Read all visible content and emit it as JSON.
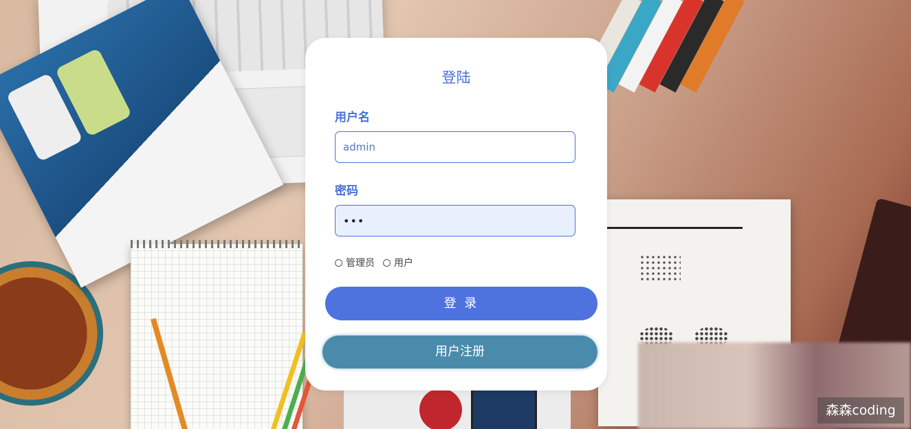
{
  "login": {
    "title": "登陆",
    "username_label": "用户名",
    "username_value": "admin",
    "password_label": "密码",
    "password_value": "•••",
    "roles": [
      "管理员",
      "用户"
    ],
    "login_button": "登 录",
    "register_button": "用户注册"
  },
  "watermark": {
    "text": "森森coding"
  },
  "colors": {
    "accent": "#4a6fd8",
    "login_button": "#4e73df",
    "register_button": "#4a8bab"
  }
}
